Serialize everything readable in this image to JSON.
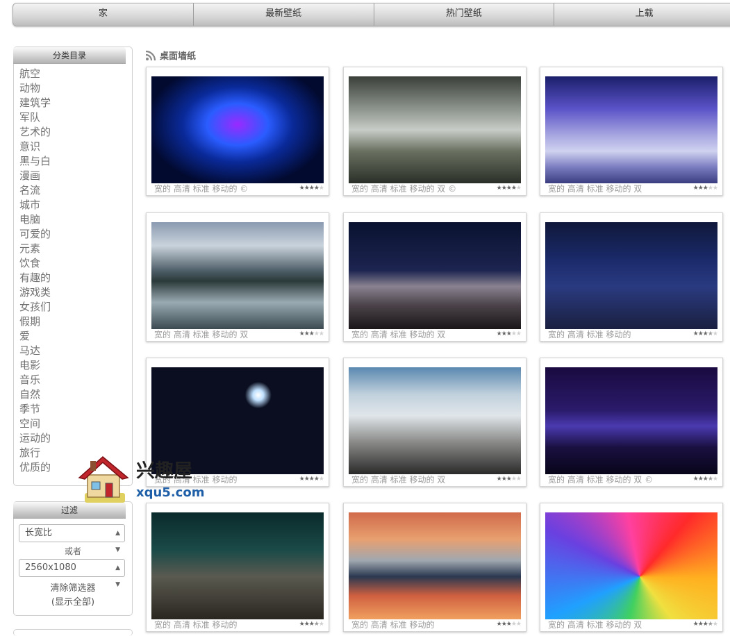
{
  "nav": [
    "家",
    "最新壁纸",
    "热门壁纸",
    "上载"
  ],
  "sidebar": {
    "categories_title": "分类目录",
    "categories": [
      "航空",
      "动物",
      "建筑学",
      "军队",
      "艺术的",
      "意识",
      "黑与白",
      "漫画",
      "名流",
      "城市",
      "电脑",
      "可爱的",
      "元素",
      "饮食",
      "有趣的",
      "游戏类",
      "女孩们",
      "假期",
      "爱",
      "马达",
      "电影",
      "音乐",
      "自然",
      "季节",
      "空间",
      "运动的",
      "旅行",
      "优质的"
    ],
    "filter_title": "过滤",
    "aspect_select": "长宽比",
    "or_label": "或者",
    "resolution_select": "2560x1080",
    "clear_filter": "清除筛选器",
    "show_all": "(显示全部)"
  },
  "main": {
    "section_title": "桌面墙纸",
    "wallpapers": [
      {
        "meta": "宽的 高清 标准 移动的 ©",
        "rating": 4
      },
      {
        "meta": "宽的 高清 标准 移动的 双 ©",
        "rating": 4
      },
      {
        "meta": "宽的 高清 标准 移动的 双",
        "rating": 3
      },
      {
        "meta": "宽的 高清 标准 移动的 双",
        "rating": 3
      },
      {
        "meta": "宽的 高清 标准 移动的 双",
        "rating": 3
      },
      {
        "meta": "宽的 高清 标准 移动的",
        "rating": 3.5
      },
      {
        "meta": "宽的 高清 标准 移动的",
        "rating": 4
      },
      {
        "meta": "宽的 高清 标准 移动的 双",
        "rating": 3
      },
      {
        "meta": "宽的 高清 标准 移动的 双 ©",
        "rating": 3.5
      },
      {
        "meta": "宽的 高清 标准 移动的",
        "rating": 3.5
      },
      {
        "meta": "宽的 高清 标准 移动的",
        "rating": 3
      },
      {
        "meta": "宽的 高清 标准 移动的 双",
        "rating": 3.5
      }
    ]
  },
  "watermark": {
    "title": "兴趣屋",
    "url": "xqu5.com"
  }
}
